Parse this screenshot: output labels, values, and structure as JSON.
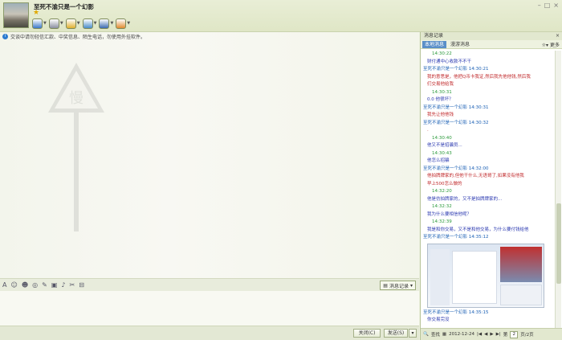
{
  "window": {
    "title": "至死不渝只是一个幻影",
    "star": "★"
  },
  "toolbar": {
    "tools": [
      {
        "icon": "video-call-icon",
        "color": "#3c78c8"
      },
      {
        "icon": "voice-call-icon",
        "color": "#8a8fa0"
      },
      {
        "icon": "send-file-icon",
        "color": "#e0b030"
      },
      {
        "icon": "remote-desktop-icon",
        "color": "#4a8cc8"
      },
      {
        "icon": "screen-share-icon",
        "color": "#3a6ab0"
      },
      {
        "icon": "app-icon",
        "color": "#e08a30"
      }
    ]
  },
  "notice": "交谈中请勿轻信汇款、中奖信息、陌生电话，勿使用外挂软件。",
  "sign_text": "慢",
  "input_toolbar": {
    "icons": [
      "font-icon",
      "emoji-icon",
      "magic-face-icon",
      "shake-icon",
      "edit-icon",
      "image-icon",
      "music-icon",
      "screenshot-icon",
      "more-icon"
    ],
    "records_label": "消息记录"
  },
  "bottom": {
    "close_label": "关闭(C)",
    "send_label": "发送(S)"
  },
  "history": {
    "header": "消息记录",
    "tabs": [
      "本地消息",
      "漫游消息"
    ],
    "more_label": "更多",
    "messages": [
      {
        "cls": "me",
        "text": "14:30:22"
      },
      {
        "cls": "body-b",
        "text": "财付通中心收款不不干"
      },
      {
        "cls": "sender",
        "text": "至死不渝只是一个幻影 14:30:21"
      },
      {
        "cls": "body-r",
        "text": "我的意思是，他把Q币卡我证,然后我先他他钱,然后我"
      },
      {
        "cls": "body-r",
        "text": "们交易他给我"
      },
      {
        "cls": "me",
        "text": "14:30:31"
      },
      {
        "cls": "body-b",
        "text": "0.0 他很坏？"
      },
      {
        "cls": "sender",
        "text": "至死不渝只是一个幻影 14:30:31"
      },
      {
        "cls": "body-r",
        "text": "我先让他他钱"
      },
      {
        "cls": "sender",
        "text": "至死不渝只是一个幻影 14:30:32"
      },
      {
        "cls": "body-r",
        "text": "."
      },
      {
        "cls": "me",
        "text": "14:30:40"
      },
      {
        "cls": "body-b",
        "text": "他又不是招骗员..."
      },
      {
        "cls": "me",
        "text": "14:30:43"
      },
      {
        "cls": "body-b",
        "text": "他怎么招骗"
      },
      {
        "cls": "sender",
        "text": "至死不渝只是一个幻影 14:32:00"
      },
      {
        "cls": "body-r",
        "text": "  他拍牌牌家的,但他干什么,无语哥了,如果没有他我"
      },
      {
        "cls": "body-r",
        "text": "早上500怎么做的"
      },
      {
        "cls": "me",
        "text": "14:32:20"
      },
      {
        "cls": "body-b",
        "text": "他是仿拍牌家的，又不是拍牌牌家的..."
      },
      {
        "cls": "me",
        "text": "14:32:32"
      },
      {
        "cls": "body-b",
        "text": "我为什么要相信他呢？"
      },
      {
        "cls": "me",
        "text": "14:32:39"
      },
      {
        "cls": "body-b",
        "text": "我是和你交易，又不是和他交易，为什么要付钱给他"
      },
      {
        "cls": "sender",
        "text": "至死不渝只是一个幻影 14:35:12"
      }
    ],
    "after_image": [
      {
        "cls": "sender",
        "text": "至死不渝只是一个幻影 14:35:15"
      },
      {
        "cls": "body-b",
        "text": "你交易完没"
      }
    ],
    "footer": {
      "search_label": "查找",
      "date": "2012-12-24",
      "page_label": "第",
      "page_value": "2",
      "total": "页/2页"
    }
  }
}
